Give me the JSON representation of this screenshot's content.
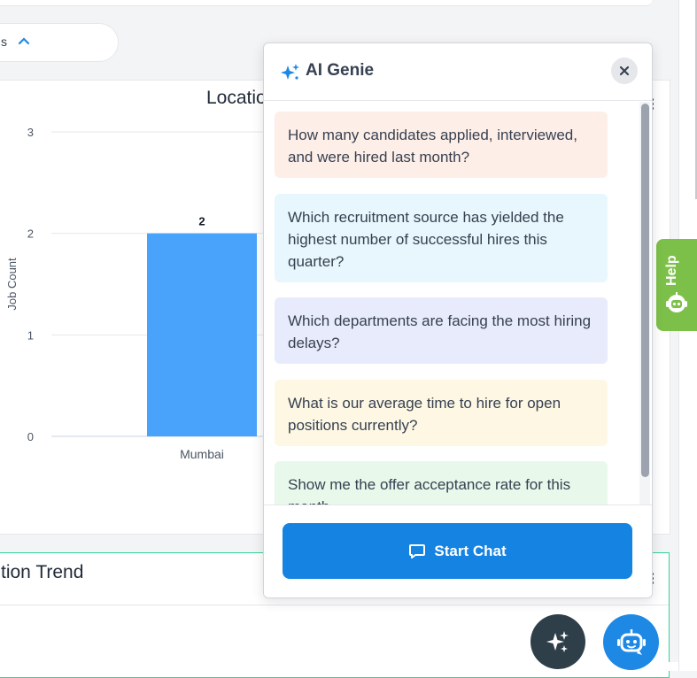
{
  "background": {
    "pill_text": "s",
    "chart_card": {
      "title": "Locatio",
      "chart_data": {
        "type": "bar",
        "categories": [
          "Mumbai"
        ],
        "values": [
          2
        ],
        "data_labels": [
          "2"
        ],
        "ylabel": "Job Count",
        "yticks": [
          "0",
          "1",
          "2",
          "3"
        ],
        "ylim": [
          0,
          3
        ],
        "grid": true,
        "bar_color": "#4aa3fb"
      }
    },
    "trend_card": {
      "title": "tion Trend"
    }
  },
  "help_tab": {
    "label": "Help",
    "color": "#7cc04a"
  },
  "ai_panel": {
    "title": "AI Genie",
    "close_icon": "close-icon",
    "suggestions": [
      "How many candidates applied, interviewed, and were hired last month?",
      "Which recruitment source has yielded the highest number of successful hires this quarter?",
      "Which departments are facing the most hiring delays?",
      "What is our average time to hire for open positions currently?",
      "Show me the offer acceptance rate for this month."
    ],
    "start_button": "Start Chat",
    "accent": "#1483e1"
  },
  "fabs": {
    "sparkle": "sparkle-icon",
    "bot": "bot-icon"
  }
}
